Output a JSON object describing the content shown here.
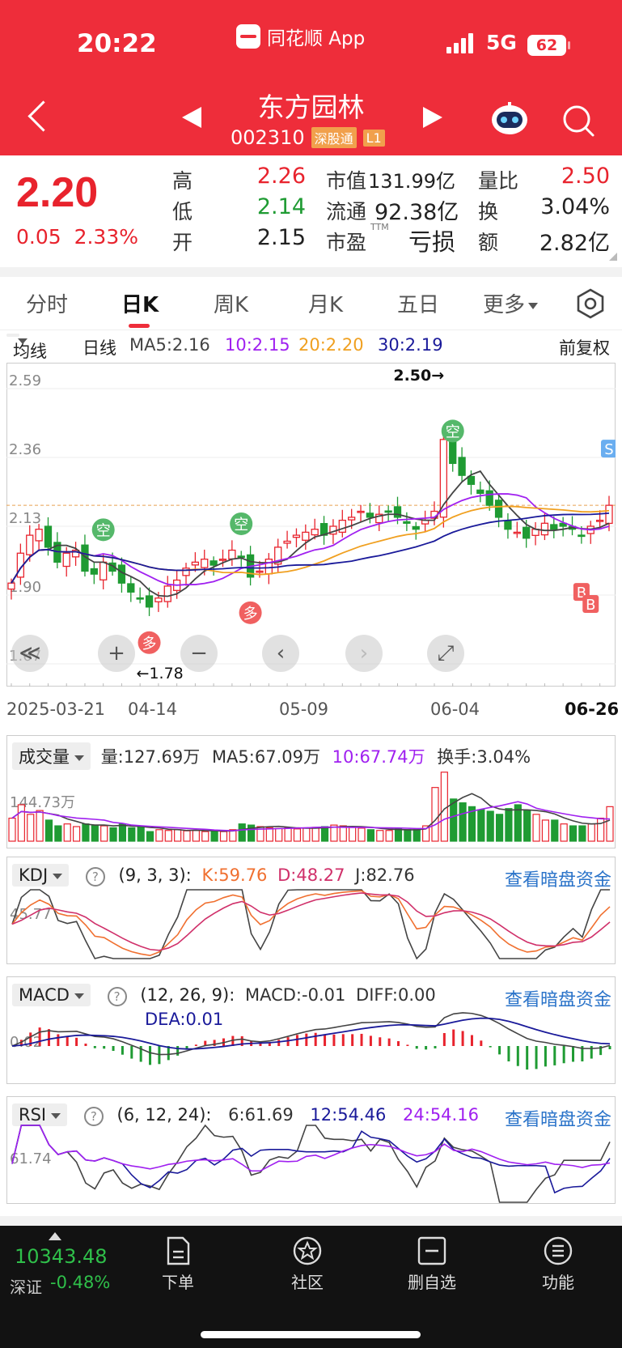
{
  "status": {
    "time": "20:22",
    "app": "同花顺 App",
    "network": "5G",
    "battery": "62"
  },
  "stock": {
    "name": "东方园林",
    "code": "002310",
    "tag1": "深股通",
    "tag2": "L1"
  },
  "quote": {
    "price": "2.20",
    "change": "0.05",
    "change_pct": "2.33%",
    "high_label": "高",
    "high": "2.26",
    "low_label": "低",
    "low": "2.14",
    "open_label": "开",
    "open": "2.15",
    "mktcap_label": "市值",
    "mktcap": "131.99亿",
    "float_label": "流通",
    "float": "92.38亿",
    "pe_label": "市盈",
    "pe_sup": "TTM",
    "pe": "亏损",
    "vol_ratio_label": "量比",
    "vol_ratio": "2.50",
    "turnover_label": "换",
    "turnover": "3.04%",
    "amount_label": "额",
    "amount": "2.82亿"
  },
  "tabs": [
    {
      "label": "分时"
    },
    {
      "label": "日K"
    },
    {
      "label": "周K"
    },
    {
      "label": "月K"
    },
    {
      "label": "五日"
    },
    {
      "label": "更多"
    }
  ],
  "ma_row": {
    "selector": "均线",
    "period": "日线",
    "ma5": "MA5:2.16",
    "ma10": "10:2.15",
    "ma20": "20:2.20",
    "ma30": "30:2.19",
    "adjust": "前复权"
  },
  "colors": {
    "up": "#e8232d",
    "down": "#1f9b33",
    "ma5": "#444444",
    "ma10": "#a020f0",
    "ma20": "#f0a020",
    "ma30": "#1a1a9a"
  },
  "chart_data": [
    {
      "type": "candlestick",
      "title": "",
      "y_ticks": [
        "2.59",
        "2.36",
        "2.13",
        "1.90",
        "1.67"
      ],
      "ylim": [
        1.67,
        2.59
      ],
      "x_ticks": [
        "2025-03-21",
        "04-14",
        "05-09",
        "06-04",
        "06-26"
      ],
      "annotations": {
        "max": "2.50→",
        "min": "←1.78"
      },
      "signals": [
        {
          "text": "空",
          "index": 10
        },
        {
          "text": "多",
          "index": 15
        },
        {
          "text": "空",
          "index": 25
        },
        {
          "text": "多",
          "index": 26
        },
        {
          "text": "空",
          "index": 48
        },
        {
          "text": "S",
          "index": 65
        },
        {
          "text": "B",
          "index": 62
        },
        {
          "text": "B",
          "index": 63
        }
      ],
      "close": [
        1.94,
        2.04,
        2.1,
        2.12,
        2.06,
        2.01,
        2.04,
        2.05,
        1.98,
        1.97,
        2.01,
        1.98,
        1.94,
        1.91,
        1.89,
        1.86,
        1.89,
        1.93,
        1.95,
        1.99,
        2.01,
        2.02,
        2.0,
        2.02,
        2.05,
        2.03,
        1.96,
        1.98,
        2.02,
        2.06,
        2.08,
        2.1,
        2.11,
        2.12,
        2.1,
        2.13,
        2.15,
        2.16,
        2.18,
        2.16,
        2.17,
        2.18,
        2.16,
        2.14,
        2.12,
        2.15,
        2.18,
        2.42,
        2.34,
        2.3,
        2.27,
        2.24,
        2.2,
        2.16,
        2.12,
        2.11,
        2.09,
        2.12,
        2.14,
        2.12,
        2.13,
        2.12,
        2.1,
        2.13,
        2.15,
        2.2
      ]
    },
    {
      "type": "bar",
      "title": "成交量",
      "labels": {
        "vol": "量:127.69万",
        "ma5": "MA5:67.09万",
        "ma10": "10:67.74万",
        "turnover": "换手:3.04%"
      },
      "y_ticks": [
        "144.73万"
      ],
      "values": [
        60,
        95,
        70,
        80,
        55,
        40,
        45,
        38,
        45,
        42,
        40,
        35,
        45,
        35,
        38,
        25,
        30,
        28,
        30,
        27,
        28,
        25,
        26,
        25,
        30,
        45,
        42,
        38,
        35,
        33,
        35,
        32,
        34,
        36,
        38,
        42,
        40,
        36,
        34,
        30,
        28,
        28,
        32,
        30,
        30,
        40,
        140,
        180,
        110,
        100,
        90,
        82,
        78,
        70,
        85,
        95,
        80,
        70,
        55,
        55,
        45,
        40,
        40,
        45,
        60,
        90
      ]
    },
    {
      "type": "line",
      "title": "KDJ",
      "params": "(9, 3, 3):",
      "k": "K:59.76",
      "d": "D:48.27",
      "j": "J:82.76",
      "y_ticks": [
        "45.77"
      ]
    },
    {
      "type": "bar",
      "title": "MACD",
      "params": "(12, 26, 9):",
      "macd": "MACD:-0.01",
      "diff": "DIFF:0.00",
      "dea": "DEA:0.01",
      "y_ticks": [
        "0.02"
      ]
    },
    {
      "type": "line",
      "title": "RSI",
      "params": "(6, 12, 24):",
      "rsi6": "6:61.69",
      "rsi12": "12:54.46",
      "rsi24": "24:54.16",
      "y_ticks": [
        "61.74"
      ]
    }
  ],
  "link_text": "查看暗盘资金",
  "bottom": {
    "index_value": "10343.48",
    "index_name": "深证",
    "index_change": "-0.48%",
    "nav": [
      {
        "label": "下单"
      },
      {
        "label": "社区"
      },
      {
        "label": "删自选"
      },
      {
        "label": "功能"
      }
    ]
  }
}
